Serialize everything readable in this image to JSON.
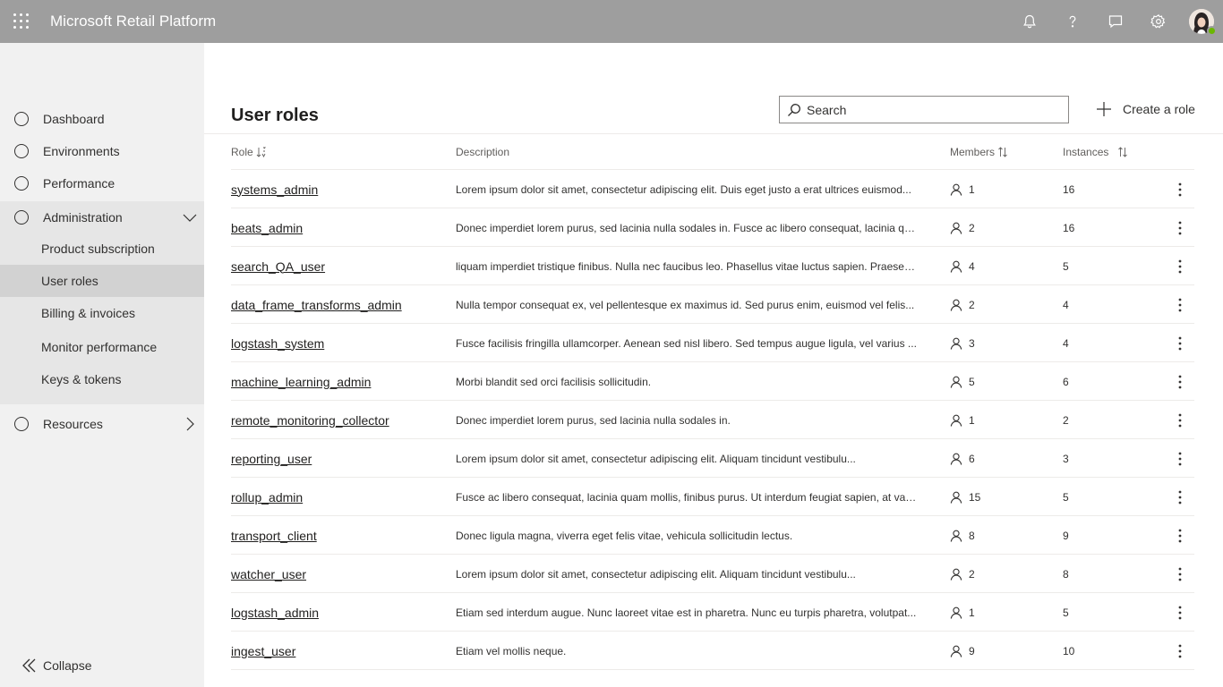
{
  "app": {
    "title": "Microsoft Retail Platform"
  },
  "topbar": {
    "icons": [
      "notification-bell-icon",
      "help-icon",
      "feedback-icon",
      "settings-gear-icon"
    ]
  },
  "sidebar": {
    "items": [
      {
        "label": "Dashboard"
      },
      {
        "label": "Environments"
      },
      {
        "label": "Performance"
      },
      {
        "label": "Administration"
      }
    ],
    "admin_subitems": [
      {
        "label": "Product subscription"
      },
      {
        "label": "User roles"
      },
      {
        "label": "Billing & invoices"
      },
      {
        "label": "Monitor performance"
      },
      {
        "label": "Keys & tokens"
      }
    ],
    "resources": {
      "label": "Resources"
    },
    "collapse_label": "Collapse"
  },
  "page": {
    "title": "User roles",
    "search_placeholder": "Search",
    "create_label": "Create a role"
  },
  "table": {
    "headers": {
      "role": "Role",
      "description": "Description",
      "members": "Members",
      "instances": "Instances"
    },
    "rows": [
      {
        "role": "systems_admin",
        "description": "Lorem ipsum dolor sit amet, consectetur adipiscing elit. Duis eget justo a erat ultrices euismod...",
        "members": "1",
        "instances": "16"
      },
      {
        "role": "beats_admin",
        "description": "Donec imperdiet lorem purus, sed lacinia nulla sodales in. Fusce ac libero consequat, lacinia qua...",
        "members": "2",
        "instances": "16"
      },
      {
        "role": "search_QA_user",
        "description": "liquam imperdiet tristique finibus. Nulla nec faucibus leo. Phasellus vitae luctus sapien. Praesent...",
        "members": "4",
        "instances": "5"
      },
      {
        "role": "data_frame_transforms_admin",
        "description": "Nulla tempor consequat ex, vel pellentesque ex maximus id. Sed purus enim, euismod vel felis...",
        "members": "2",
        "instances": "4"
      },
      {
        "role": "logstash_system",
        "description": "Fusce facilisis fringilla ullamcorper. Aenean sed nisl libero. Sed tempus augue ligula, vel varius ...",
        "members": "3",
        "instances": "4"
      },
      {
        "role": "machine_learning_admin",
        "description": "Morbi blandit sed orci facilisis sollicitudin.",
        "members": "5",
        "instances": "6"
      },
      {
        "role": "remote_monitoring_collector",
        "description": "Donec imperdiet lorem purus, sed lacinia nulla sodales in.",
        "members": "1",
        "instances": "2"
      },
      {
        "role": "reporting_user",
        "description": "Lorem ipsum dolor sit amet, consectetur adipiscing elit. Aliquam tincidunt vestibulu...",
        "members": "6",
        "instances": "3"
      },
      {
        "role": "rollup_admin",
        "description": "Fusce ac libero consequat, lacinia quam mollis, finibus purus. Ut interdum feugiat sapien, at var...",
        "members": "15",
        "instances": "5"
      },
      {
        "role": "transport_client",
        "description": "Donec ligula magna, viverra eget felis vitae, vehicula sollicitudin lectus.",
        "members": "8",
        "instances": "9"
      },
      {
        "role": "watcher_user",
        "description": "Lorem ipsum dolor sit amet, consectetur adipiscing elit. Aliquam tincidunt vestibulu...",
        "members": "2",
        "instances": "8"
      },
      {
        "role": "logstash_admin",
        "description": "Etiam sed interdum augue. Nunc laoreet vitae est in pharetra. Nunc eu turpis pharetra, volutpat...",
        "members": "1",
        "instances": "5"
      },
      {
        "role": "ingest_user",
        "description": "Etiam vel mollis neque.",
        "members": "9",
        "instances": "10"
      }
    ]
  }
}
